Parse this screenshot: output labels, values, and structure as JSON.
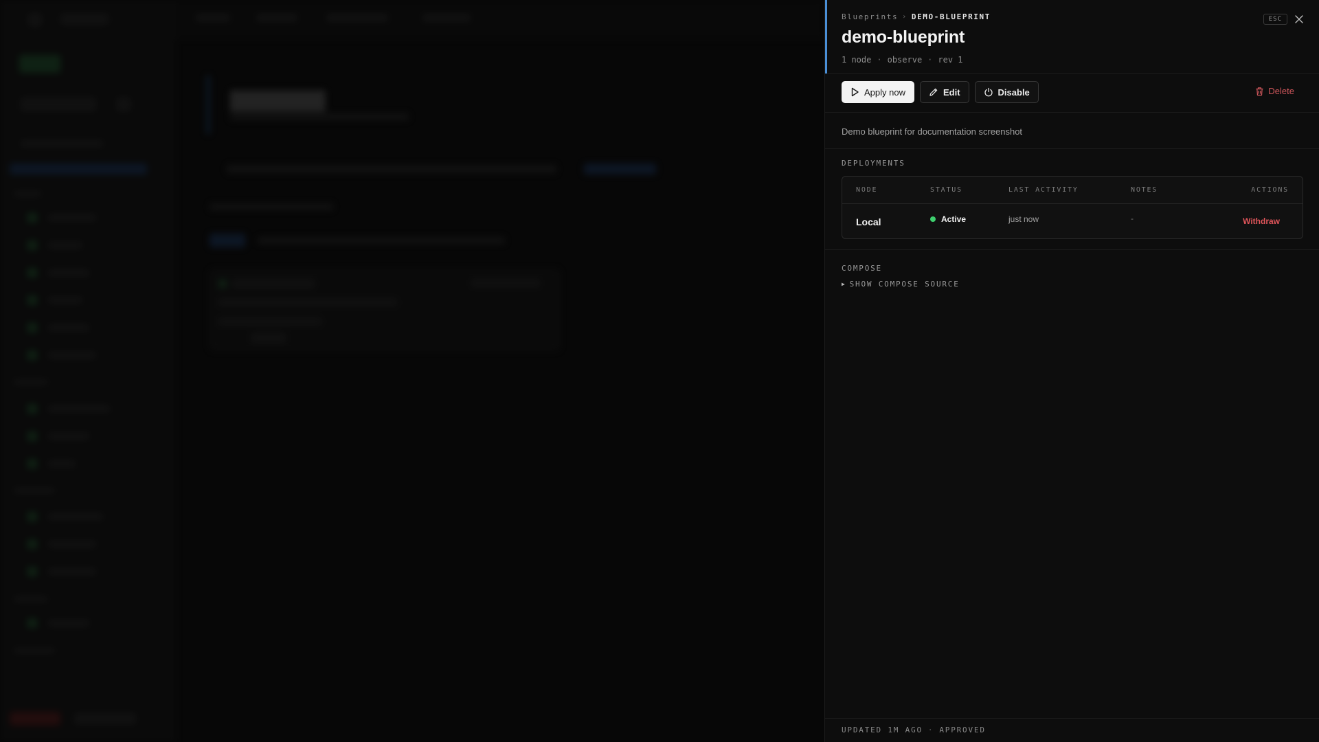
{
  "drawer": {
    "breadcrumb": {
      "root": "Blueprints",
      "separator": "›",
      "current": "DEMO-BLUEPRINT"
    },
    "title": "demo-blueprint",
    "meta": [
      "1 node",
      "observe",
      "rev 1"
    ],
    "meta_separator": "·",
    "esc_label": "ESC",
    "close_icon": "close-icon",
    "accent_color": "#4a8fd6"
  },
  "toolbar": {
    "apply_label": "Apply now",
    "edit_label": "Edit",
    "disable_label": "Disable",
    "delete_label": "Delete",
    "delete_color": "#d0575c"
  },
  "description": "Demo blueprint for documentation screenshot",
  "deployments": {
    "label": "DEPLOYMENTS",
    "columns": [
      "NODE",
      "STATUS",
      "LAST ACTIVITY",
      "NOTES",
      "ACTIONS"
    ],
    "rows": [
      {
        "node": "Local",
        "status": "Active",
        "status_color": "#3ecf6e",
        "last_activity": "just now",
        "notes": "-",
        "action": "Withdraw"
      }
    ]
  },
  "compose": {
    "label": "COMPOSE",
    "toggle_label": "SHOW COMPOSE SOURCE"
  },
  "footer": {
    "updated": "UPDATED 1M AGO",
    "separator": "·",
    "state": "APPROVED"
  }
}
